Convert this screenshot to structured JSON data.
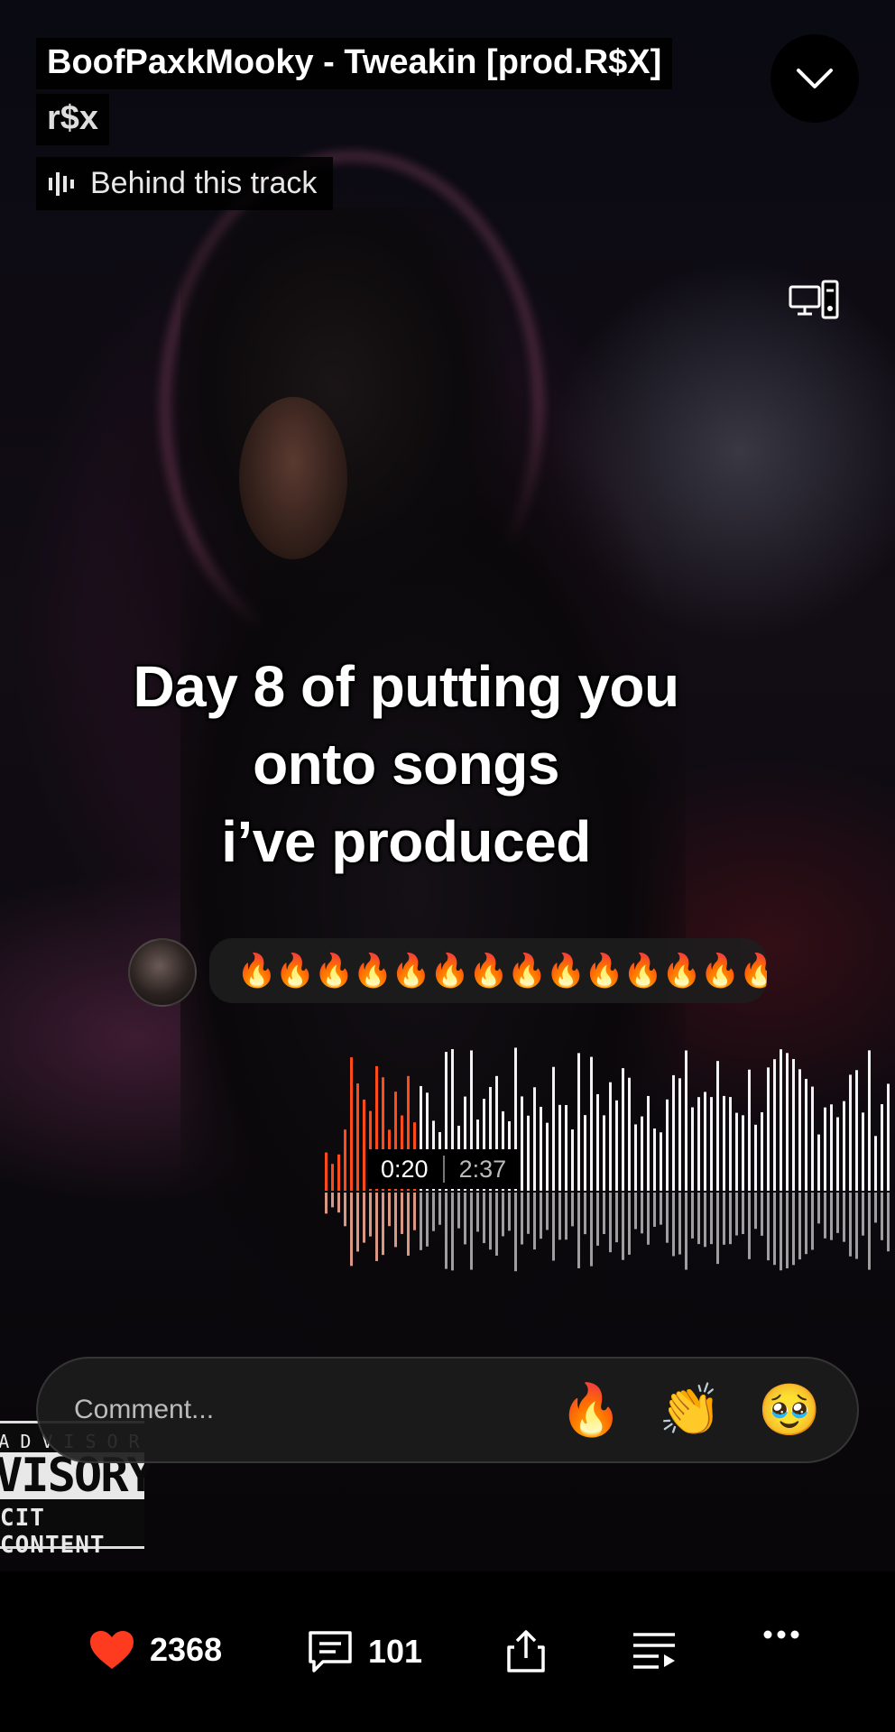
{
  "track": {
    "title": "BoofPaxkMooky - Tweakin [prod.R$X]",
    "artist": "r$x",
    "behind_label": "Behind this track"
  },
  "caption": {
    "line1": "Day 8 of putting you",
    "line2": "onto songs",
    "line3": "i’ve produced"
  },
  "featured_comment": {
    "text": "🔥🔥🔥🔥🔥🔥🔥🔥🔥🔥🔥🔥🔥🔥!"
  },
  "player": {
    "current_time": "0:20",
    "duration": "2:37",
    "progress": 0.127,
    "accent": "#ff4a1a"
  },
  "comment_bar": {
    "placeholder": "Comment...",
    "reactions": [
      "🔥",
      "👏",
      "🥹"
    ]
  },
  "album_art": {
    "advisory": [
      "RENTAL ADVISORY",
      "VISORY",
      "CIT CONTENT"
    ]
  },
  "actions": {
    "likes": "2368",
    "comments": "101",
    "like_color": "#ff3b1f"
  },
  "icons": [
    "chevron-down-icon",
    "cast-icon",
    "sound-bars-icon",
    "heart-icon",
    "comment-icon",
    "share-icon",
    "queue-icon",
    "more-icon"
  ]
}
